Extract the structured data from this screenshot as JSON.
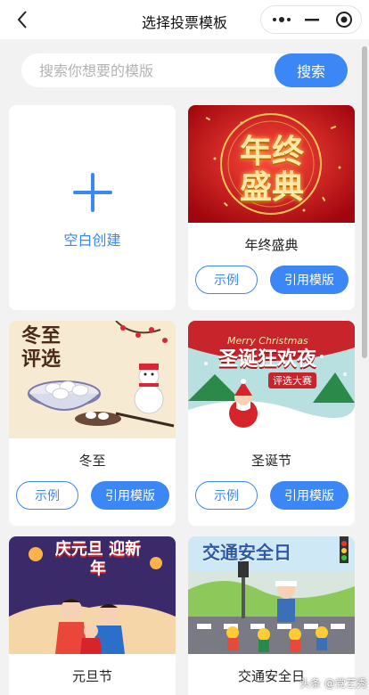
{
  "nav": {
    "title": "选择投票模板",
    "more_icon": "more-dots-icon",
    "minimize_icon": "minimize-icon",
    "close_icon": "target-circle-icon"
  },
  "search": {
    "placeholder": "搜索你想要的模版",
    "value": "",
    "button_label": "搜索"
  },
  "blank": {
    "label": "空白创建"
  },
  "templates": [
    {
      "name": "年终盛典",
      "art_text": "年终盛典",
      "example_label": "示例",
      "use_label": "引用模版"
    },
    {
      "name": "冬至",
      "art_text": "冬至 评选",
      "example_label": "示例",
      "use_label": "引用模版"
    },
    {
      "name": "圣诞节",
      "art_text": "圣诞狂欢夜",
      "art_sub": "评选大赛",
      "art_en": "Merry Christmas",
      "example_label": "示例",
      "use_label": "引用模版"
    },
    {
      "name": "元旦节",
      "art_text": "庆元旦 迎新年"
    },
    {
      "name": "交通安全日",
      "art_text": "交通安全日"
    }
  ],
  "watermark": "头条 @党艺秀",
  "colors": {
    "accent": "#3b87f5",
    "background": "#f2f2f2"
  }
}
